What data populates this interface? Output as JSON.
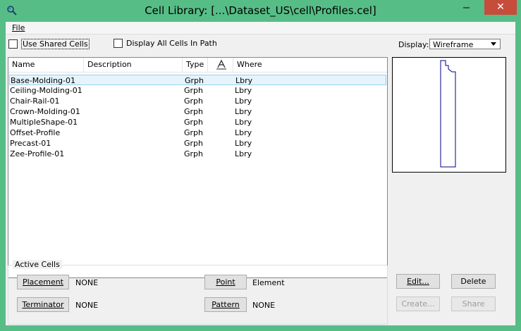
{
  "window": {
    "title": "Cell Library: [...\\Dataset_US\\cell\\Profiles.cel]",
    "close_symbol": "✕"
  },
  "menu": {
    "file": "File"
  },
  "options": {
    "use_shared_cells": "Use Shared Cells",
    "display_all_cells": "Display All Cells In Path"
  },
  "display": {
    "label": "Display:",
    "value": "Wireframe"
  },
  "table": {
    "headers": {
      "name": "Name",
      "description": "Description",
      "type": "Type",
      "where": "Where"
    },
    "rows": [
      {
        "name": "Base-Molding-01",
        "description": "",
        "type": "Grph",
        "where": "Lbry"
      },
      {
        "name": "Ceiling-Molding-01",
        "description": "",
        "type": "Grph",
        "where": "Lbry"
      },
      {
        "name": "Chair-Rail-01",
        "description": "",
        "type": "Grph",
        "where": "Lbry"
      },
      {
        "name": "Crown-Molding-01",
        "description": "",
        "type": "Grph",
        "where": "Lbry"
      },
      {
        "name": "MultipleShape-01",
        "description": "",
        "type": "Grph",
        "where": "Lbry"
      },
      {
        "name": "Offset-Profile",
        "description": "",
        "type": "Grph",
        "where": "Lbry"
      },
      {
        "name": "Precast-01",
        "description": "",
        "type": "Grph",
        "where": "Lbry"
      },
      {
        "name": "Zee-Profile-01",
        "description": "",
        "type": "Grph",
        "where": "Lbry"
      }
    ]
  },
  "active_cells": {
    "title": "Active Cells",
    "placement_button": "Placement",
    "placement_value": "NONE",
    "terminator_button": "Terminator",
    "terminator_value": "NONE",
    "point_button": "Point",
    "point_value": "Element",
    "pattern_button": "Pattern",
    "pattern_value": "NONE"
  },
  "actions": {
    "edit": "Edit...",
    "delete": "Delete",
    "create": "Create...",
    "share": "Share"
  },
  "colors": {
    "titlebar": "#57bd86",
    "close": "#c74c3c",
    "preview_stroke": "#00008b"
  }
}
